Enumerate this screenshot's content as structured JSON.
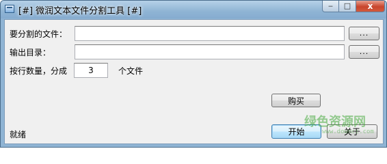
{
  "window": {
    "title": "[#] 微润文本文件分割工具 [#]",
    "controls": {
      "minimize": "‒",
      "maximize": "□",
      "close": "x"
    }
  },
  "form": {
    "file_label": "要分割的文件：",
    "file_value": "",
    "browse_label": "...",
    "output_label": "输出目录：",
    "output_value": "",
    "lines_label": "按行数量，分成",
    "count_value": "3",
    "unit_label": "个文件"
  },
  "buttons": {
    "buy": "购买",
    "start": "开始",
    "about": "关于"
  },
  "status": {
    "text": "就绪"
  },
  "watermark": {
    "text": "绿色资源网",
    "url": "www.downcc.com"
  },
  "colors": {
    "titlebar": "#8fb4d4",
    "client_bg": "#f0f0f0",
    "close_button": "#c8452c",
    "default_button": "#3c7fb1",
    "watermark": "#46aa3c"
  }
}
